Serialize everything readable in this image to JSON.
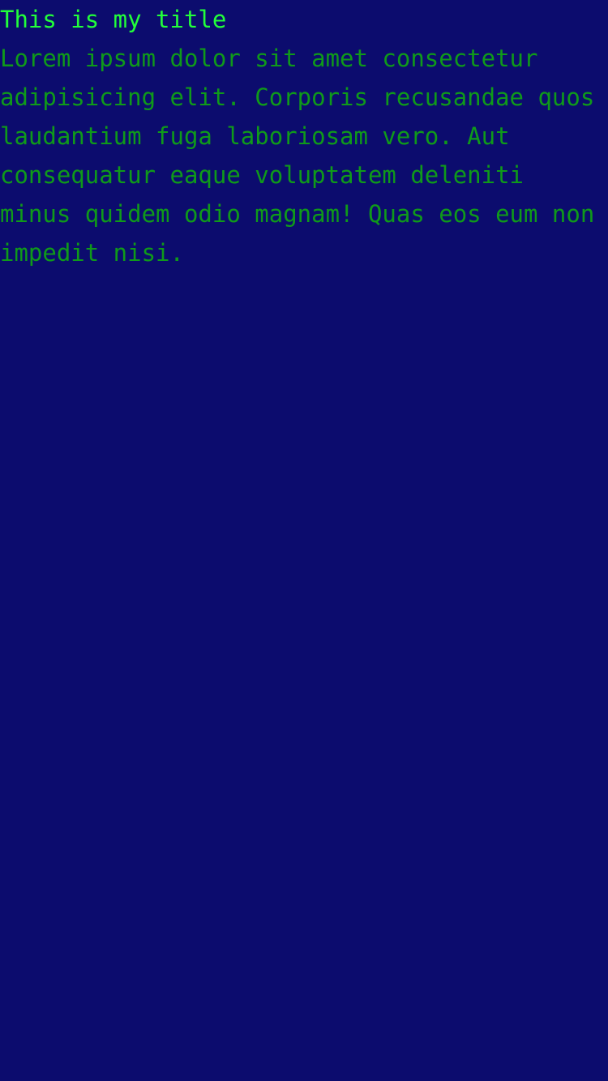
{
  "page": {
    "title": "This is my title",
    "body": "Lorem ipsum dolor sit amet consectetur adipisicing elit. Corporis recusandae quos laudantium fuga laboriosam vero. Aut consequatur eaque voluptatem deleniti minus quidem odio magnam! Quas eos eum non impedit nisi."
  },
  "colors": {
    "background": "#0c0c6e",
    "title": "#22ff3a",
    "body": "#0f9a1a"
  }
}
